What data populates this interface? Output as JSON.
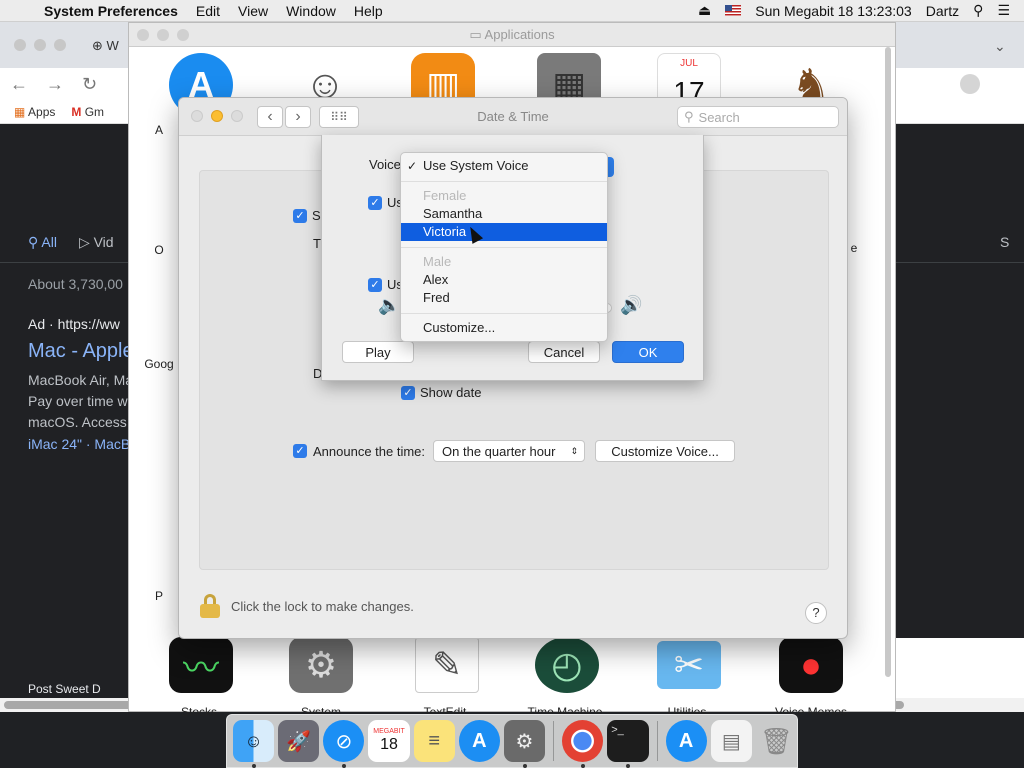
{
  "menubar": {
    "apple": "",
    "app": "System Preferences",
    "items": [
      "Edit",
      "View",
      "Window",
      "Help"
    ],
    "clock": "Sun Megabit 18  13:23:03",
    "user": "Dartz"
  },
  "browser": {
    "tab_text": "W",
    "bookmarks": [
      "Apps",
      "Gm"
    ],
    "search_tabs": [
      "All",
      "Vid"
    ],
    "tab_right_text": "S",
    "about": "About 3,730,00",
    "ad_line": "Ad · https://ww",
    "result_title": "Mac - Apple",
    "result_desc": [
      "MacBook Air, Ma",
      "Pay over time w",
      "macOS. Access"
    ],
    "result_links": "iMac 24\" · MacB",
    "footer_text": "Post Sweet D"
  },
  "finder": {
    "title": "Applications",
    "labels": {
      "stocks": "Stocks",
      "system": "System",
      "textedit": "TextEdit",
      "timemachine": "Time Machine",
      "utilities": "Utilities",
      "voicememos": "Voice Memos",
      "partial_a": "A",
      "partial_o": "O",
      "partial_goog": "Goog",
      "partial_p": "P",
      "partial_e": "e"
    },
    "calendar_month": "JUL",
    "calendar_day": "17"
  },
  "datetime": {
    "title": "Date & Time",
    "search_placeholder": "Search",
    "show_label": "Sh",
    "t_label": "T",
    "d_label": "D",
    "show_date": "Show date",
    "announce_label": "Announce the time:",
    "announce_value": "On the quarter hour",
    "customize_voice": "Customize Voice...",
    "lock_text": "Click the lock to make changes.",
    "help": "?"
  },
  "voice_sheet": {
    "voice_label": "Voice",
    "use_label_1": "Us",
    "use_label_2": "Us",
    "right_fragment": "t",
    "play": "Play",
    "cancel": "Cancel",
    "ok": "OK"
  },
  "voice_menu": {
    "checked": "Use System Voice",
    "female_header": "Female",
    "female": [
      "Samantha",
      "Victoria"
    ],
    "male_header": "Male",
    "male": [
      "Alex",
      "Fred"
    ],
    "customize": "Customize...",
    "selected": "Victoria"
  },
  "dock": {
    "calendar_month": "MEGABIT",
    "calendar_day": "18"
  },
  "colors": {
    "accent": "#2e7be9",
    "menu_highlight": "#0f5ee0",
    "ok_button": "#2f80ed"
  }
}
